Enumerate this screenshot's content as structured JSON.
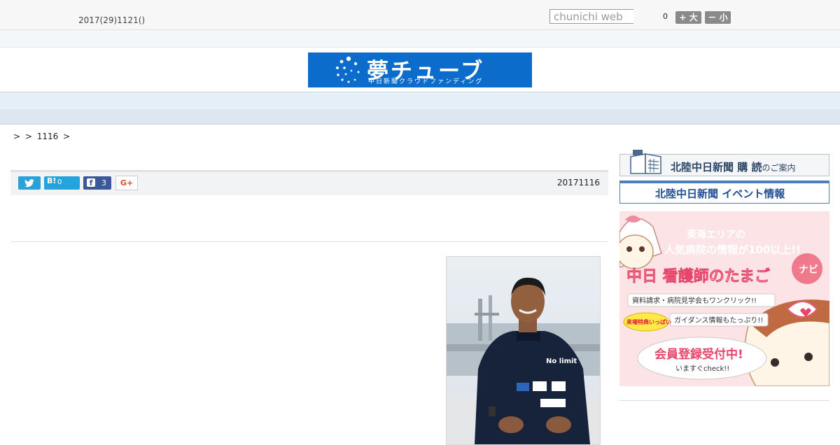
{
  "topbar": {
    "date": "2017(29)1121()",
    "search_placeholder": "chunichi web",
    "fontsize_count": "0",
    "font_large_label": "+ 大",
    "font_small_label": "－ 小"
  },
  "logo": {
    "title": "夢チューブ",
    "subtitle": "中日新聞クラウドファンディング"
  },
  "nav": {
    "items": [
      "　　",
      "　　",
      "　　",
      "　　",
      "　　",
      "　　",
      "　　",
      "　　",
      "　　"
    ]
  },
  "breadcrumb": ">  > 1116 >",
  "article": {
    "date": "20171116",
    "share": {
      "hatena_label": "B!",
      "hatena_count": "0",
      "facebook_count": "3",
      "gplus_label": "G+"
    }
  },
  "sidebar": {
    "subscribe_title": "北陸中日新聞 購 読",
    "subscribe_suffix": "のご案内",
    "event_title": "北陸中日新聞 イベント情報",
    "ad": {
      "line1": "東海エリアの",
      "line2": "人気病院の情報が100以上!!",
      "title": "中日 看護師のたまご",
      "badge": "ナビ",
      "note1": "資料請求・病院見学会もワンクリック!!",
      "tag": "来場特典いっぱい",
      "note2": "ガイダンス情報もたっぷり!!",
      "cta": "会員登録受付中!",
      "cta_sub": "いますぐcheck!!"
    }
  },
  "colors": {
    "logo_bg": "#0b6ccb",
    "nav_bg": "#e6eef6",
    "twitter": "#2aa1d8",
    "hatena": "#24a4dd",
    "facebook": "#3b5998",
    "ad_bg": "#fbe3e6"
  }
}
